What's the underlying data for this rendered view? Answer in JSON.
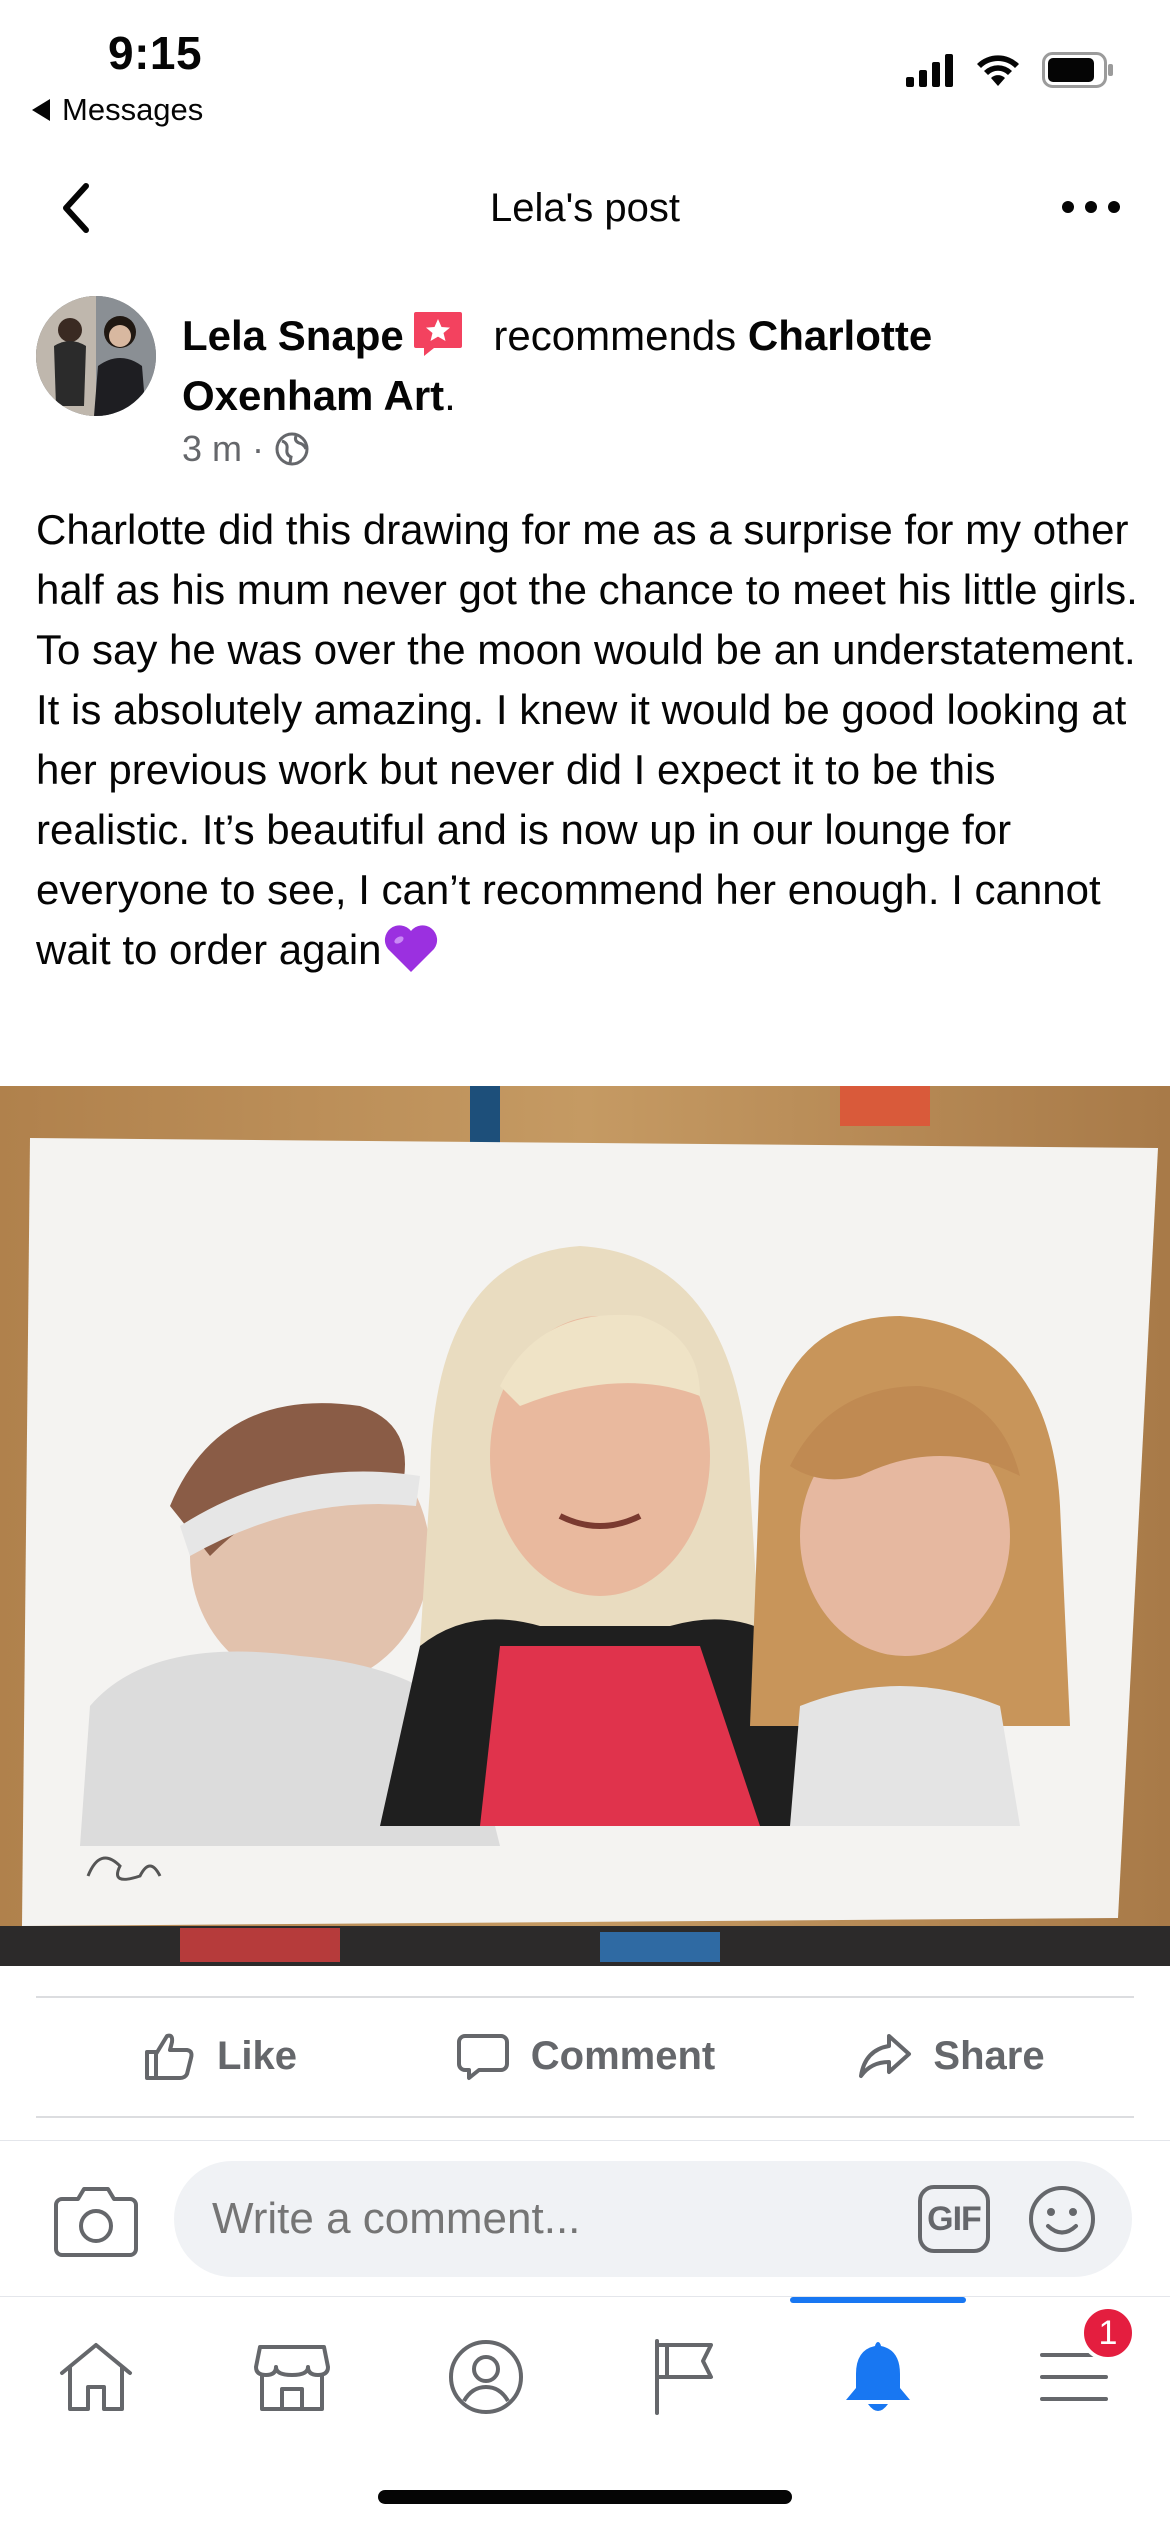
{
  "status_bar": {
    "time": "9:15",
    "back_app": "Messages"
  },
  "header": {
    "title": "Lela's post",
    "back_icon": "chevron-left-icon",
    "more_icon": "more-horizontal-icon"
  },
  "post": {
    "author_name": "Lela Snape",
    "verb": " recommends ",
    "page_name": "Charlotte Oxenham Art",
    "page_suffix": ".",
    "time_ago": "3 m",
    "meta_separator": "·",
    "privacy_icon": "globe-icon",
    "text": "Charlotte did this drawing for me as a surprise for my other half as his mum never got the chance to meet his little girls. To say he was over the moon would be an understatement. It is absolutely amazing. I knew it would be good looking at her previous work but never did I expect it to be this realistic. It’s beautiful and is now up in our lounge for everyone to see, I can’t recommend her enough. I cannot wait to order again",
    "emoji": "purple-heart-icon"
  },
  "actions": {
    "like": "Like",
    "comment": "Comment",
    "share": "Share"
  },
  "comment_bar": {
    "placeholder": "Write a comment...",
    "gif_label": "GIF"
  },
  "tabbar": {
    "items": [
      "home-icon",
      "marketplace-icon",
      "profile-icon",
      "pages-flag-icon",
      "notifications-bell-icon",
      "menu-icon"
    ],
    "active": "notifications-bell-icon",
    "menu_badge": "1"
  },
  "colors": {
    "accent": "#1877f2",
    "secondary_text": "#65676b",
    "badge_red": "#e41e3f",
    "recommend_badge": "#f3425f"
  }
}
